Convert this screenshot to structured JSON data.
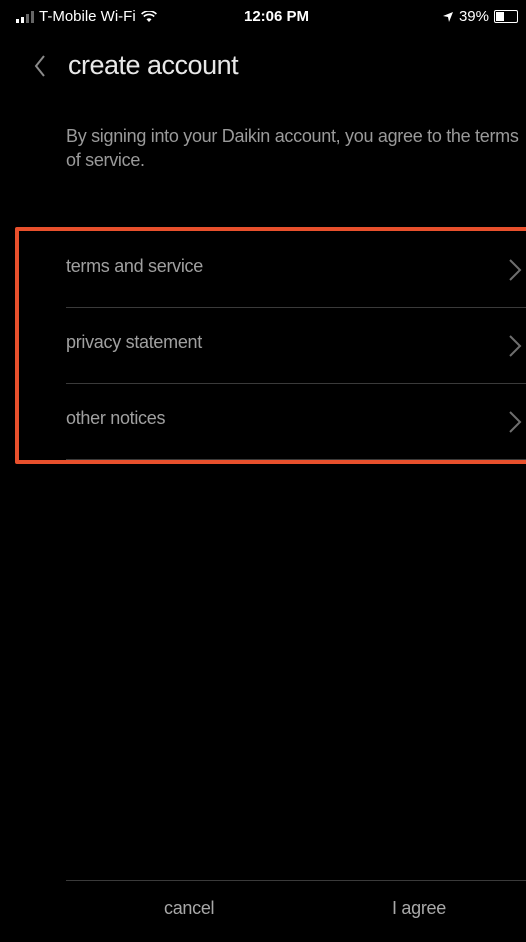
{
  "status_bar": {
    "carrier": "T-Mobile Wi-Fi",
    "time": "12:06 PM",
    "battery": "39%",
    "battery_level": 0.39
  },
  "header": {
    "title": "create account"
  },
  "intro": {
    "text": "By signing into your Daikin account, you agree to the terms of service."
  },
  "links": [
    {
      "label": "terms and service"
    },
    {
      "label": "privacy statement"
    },
    {
      "label": "other notices"
    }
  ],
  "footer": {
    "cancel_label": "cancel",
    "agree_label": "I agree"
  },
  "colors": {
    "background": "#000000",
    "highlight_border": "#e8502c"
  }
}
